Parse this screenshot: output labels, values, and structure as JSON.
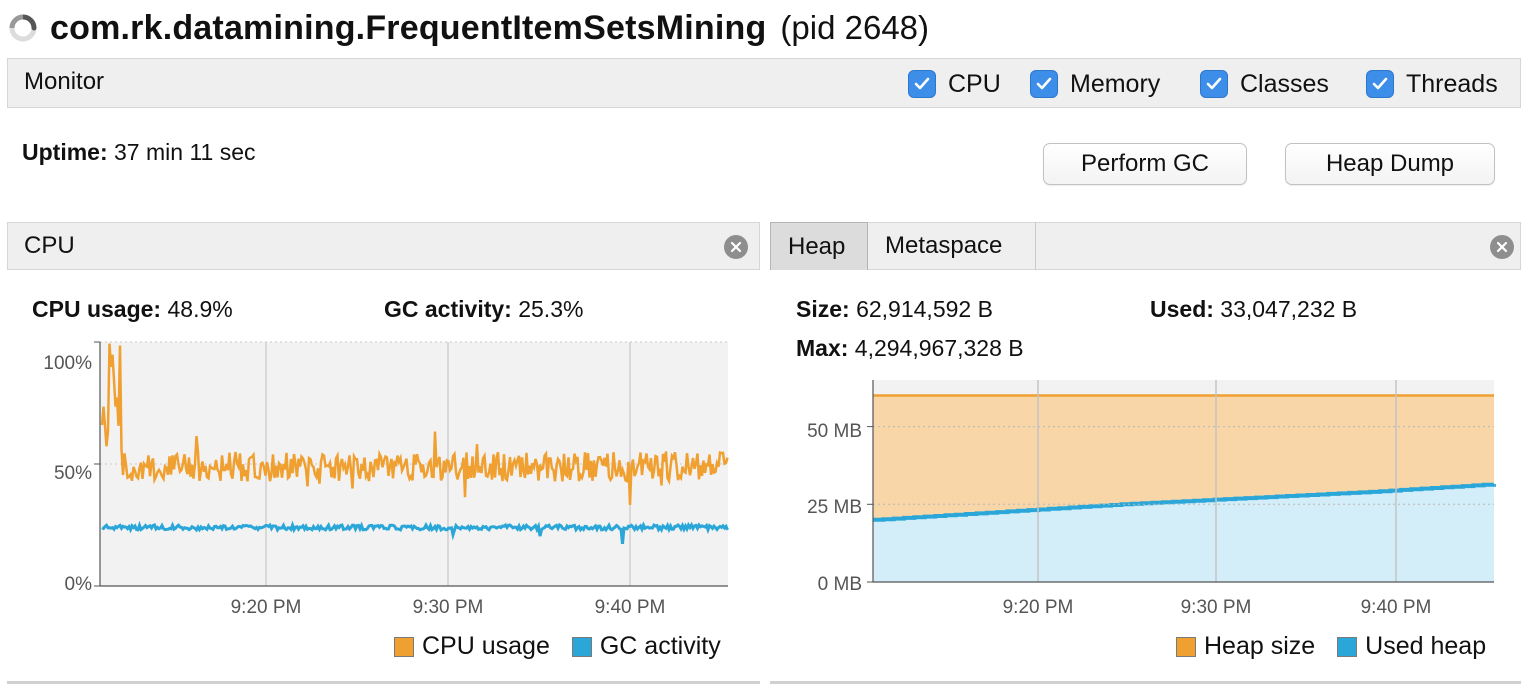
{
  "window": {
    "app_name": "com.rk.datamining.FrequentItemSetsMining",
    "pid_text": "(pid 2648)"
  },
  "monitor": {
    "label": "Monitor",
    "checkboxes": [
      {
        "label": "CPU",
        "checked": true
      },
      {
        "label": "Memory",
        "checked": true
      },
      {
        "label": "Classes",
        "checked": true
      },
      {
        "label": "Threads",
        "checked": true
      }
    ]
  },
  "uptime": {
    "label": "Uptime:",
    "value": "37 min 11 sec"
  },
  "buttons": {
    "perform_gc": "Perform GC",
    "heap_dump": "Heap Dump"
  },
  "cpu_panel": {
    "title": "CPU",
    "cpu_usage_label": "CPU usage:",
    "cpu_usage_value": "48.9%",
    "gc_activity_label": "GC activity:",
    "gc_activity_value": "25.3%"
  },
  "heap_panel": {
    "tabs": [
      "Heap",
      "Metaspace"
    ],
    "size_label": "Size:",
    "size_value": "62,914,592 B",
    "used_label": "Used:",
    "used_value": "33,047,232 B",
    "max_label": "Max:",
    "max_value": "4,294,967,328 B"
  },
  "colors": {
    "orange": "#f0a030",
    "blue": "#2aa7d8",
    "heap_fill": "#f8d6a8",
    "used_fill": "#d4eef9",
    "plot_bg": "#f2f2f2"
  },
  "chart_data": [
    {
      "type": "line",
      "title": "",
      "y_ticks": [
        "100%",
        "50%",
        "0%"
      ],
      "x_ticks": [
        "9:20 PM",
        "9:30 PM",
        "9:40 PM"
      ],
      "ylim": [
        0,
        100
      ],
      "x_range_minutes": [
        "9:11 PM",
        "9:45 PM"
      ],
      "series": [
        {
          "name": "CPU usage",
          "color": "#f0a030",
          "mean": 48.9,
          "spike_start": 100,
          "noise": 12
        },
        {
          "name": "GC activity",
          "color": "#2aa7d8",
          "mean": 24,
          "noise": 2
        }
      ],
      "legend": [
        "CPU usage",
        "GC activity"
      ]
    },
    {
      "type": "area",
      "title": "",
      "y_ticks": [
        "50 MB",
        "25 MB",
        "0 MB"
      ],
      "x_ticks": [
        "9:20 PM",
        "9:30 PM",
        "9:40 PM"
      ],
      "ylim_mb": [
        0,
        65
      ],
      "series": [
        {
          "name": "Heap size",
          "color": "#f0a030",
          "values_mb": [
            60,
            60
          ]
        },
        {
          "name": "Used heap",
          "color": "#2aa7d8",
          "values_mb": [
            20,
            22.5,
            25,
            27,
            29,
            31.5
          ]
        }
      ],
      "legend": [
        "Heap size",
        "Used heap"
      ]
    }
  ]
}
